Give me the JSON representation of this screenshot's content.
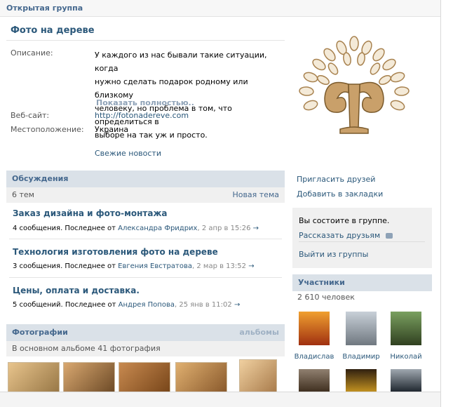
{
  "header": {
    "group_type": "Открытая группа"
  },
  "group": {
    "title": "Фото на дереве",
    "description_label": "Описание:",
    "description_lines": [
      "У каждого из нас бывали такие ситуации, когда",
      "нужно сделать подарок родному или близкому",
      "человеку, но проблема в том, что определиться в",
      "выборе на так уж и просто."
    ],
    "show_more": "Показать полностью..",
    "website_label": "Веб-сайт:",
    "website_value": "http://fotonadereve.com",
    "location_label": "Местоположение:",
    "location_value": "Украина",
    "fresh_news": "Свежие новости"
  },
  "discussions": {
    "title": "Обсуждения",
    "count": "6 тем",
    "new_topic": "Новая тема",
    "topics": [
      {
        "title": "Заказ дизайна и фото-монтажа",
        "meta_prefix": "4 сообщения. Последнее от",
        "author": "Александра Фридрих",
        "date": ", 2 апр в 15:26",
        "arrow": "→"
      },
      {
        "title": "Технология изготовления фото на дереве",
        "meta_prefix": "3 сообщения. Последнее от",
        "author": "Евгения Евстратова",
        "date": ", 2 мар в 13:52",
        "arrow": "→"
      },
      {
        "title": "Цены, оплата и доставка.",
        "meta_prefix": "5 сообщений. Последнее от",
        "author": "Андрея Попова",
        "date": ", 25 янв в 11:02",
        "arrow": "→"
      }
    ]
  },
  "photos": {
    "title": "Фотографии",
    "albums": "альбомы",
    "subtitle": "В основном альбоме 41 фотография"
  },
  "actions": {
    "invite": "Пригласить друзей",
    "bookmark": "Добавить в закладки",
    "member_status": "Вы состоите в группе.",
    "tell_friends": "Рассказать друзьям",
    "leave": "Выйти из группы"
  },
  "members": {
    "title": "Участники",
    "count": "2 610 человек",
    "people": [
      {
        "name": "Владислав"
      },
      {
        "name": "Владимир"
      },
      {
        "name": "Николай"
      }
    ]
  },
  "colors": {
    "link": "#2b587a",
    "header_bg": "#dae1e8",
    "header_text": "#45688e"
  }
}
